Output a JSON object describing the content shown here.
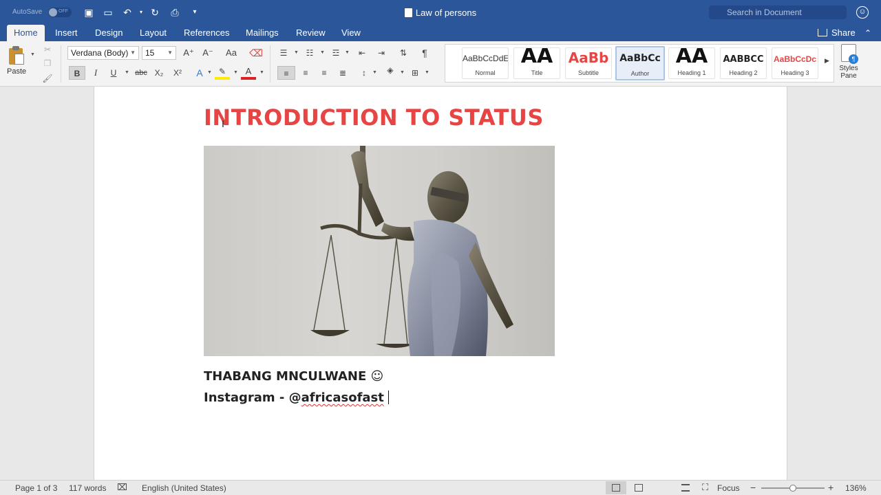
{
  "titlebar": {
    "autosave_label": "AutoSave",
    "autosave_state": "OFF",
    "doc_title": "Law of persons",
    "search_placeholder": "Search in Document"
  },
  "tabs": [
    {
      "label": "Home",
      "active": true
    },
    {
      "label": "Insert"
    },
    {
      "label": "Design"
    },
    {
      "label": "Layout"
    },
    {
      "label": "References"
    },
    {
      "label": "Mailings"
    },
    {
      "label": "Review"
    },
    {
      "label": "View"
    }
  ],
  "share_label": "Share",
  "ribbon": {
    "paste_label": "Paste",
    "font_name": "Verdana (Body)",
    "font_size": "15",
    "styles": [
      {
        "sample": "AaBbCcDdE",
        "name": "Normal"
      },
      {
        "sample": "AA",
        "name": "Title"
      },
      {
        "sample": "AaBb",
        "name": "Subtitle"
      },
      {
        "sample": "AaBbCc",
        "name": "Author",
        "selected": true
      },
      {
        "sample": "AA",
        "name": "Heading 1"
      },
      {
        "sample": "AABBCC",
        "name": "Heading 2"
      },
      {
        "sample": "AaBbCcDc",
        "name": "Heading 3"
      }
    ],
    "styles_pane_label_1": "Styles",
    "styles_pane_label_2": "Pane"
  },
  "document": {
    "heading": "INTRODUCTION TO STATUS",
    "author_line": "THABANG MNCULWANE ☺",
    "ig_prefix": "Instagram - @",
    "ig_handle": "africasofast"
  },
  "statusbar": {
    "page": "Page 1 of 3",
    "words": "117 words",
    "language": "English (United States)",
    "focus": "Focus",
    "zoom": "136%",
    "zoom_level": 0.5
  },
  "colors": {
    "accent": "#2b579a",
    "heading": "#e74444"
  }
}
